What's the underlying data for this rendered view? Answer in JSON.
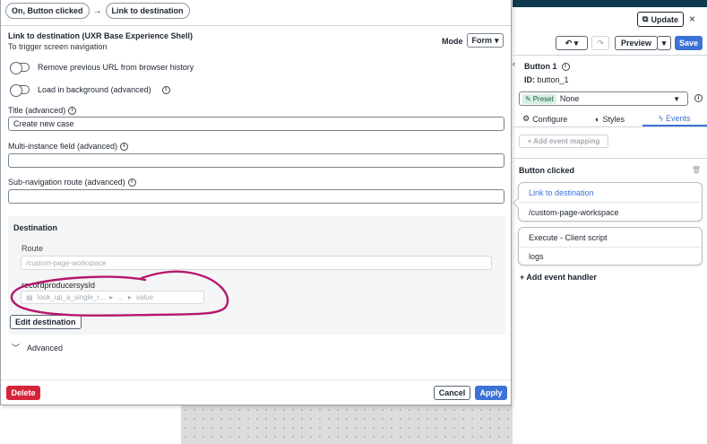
{
  "breadcrumbs": [
    "On, Button clicked",
    "Link to destination"
  ],
  "header": {
    "title": "Link to destination (UXR Base Experience Shell)",
    "subtitle": "To trigger screen navigation",
    "mode_label": "Mode",
    "mode_value": "Form"
  },
  "toggles": [
    {
      "label": "Remove previous URL from browser history"
    },
    {
      "label": "Load in background (advanced)"
    }
  ],
  "fields": {
    "title_label": "Title (advanced)",
    "title_value": "Create new case",
    "multi_label": "Multi-instance field (advanced)",
    "multi_value": "",
    "subnav_label": "Sub-navigation route (advanced)",
    "subnav_value": ""
  },
  "destination": {
    "title": "Destination",
    "route_label": "Route",
    "route_placeholder": "/custom-page-workspace",
    "param_label": "recordproducersysId",
    "param_path_1": "look_up_a_single_r...",
    "param_path_2": "...",
    "param_path_3": "value",
    "edit_button": "Edit destination",
    "advanced_label": "Advanced"
  },
  "footer": {
    "delete": "Delete",
    "cancel": "Cancel",
    "apply": "Apply"
  },
  "right_panel": {
    "update": "Update",
    "preview": "Preview",
    "save": "Save",
    "component_title": "Button 1",
    "component_id_label": "ID:",
    "component_id": "button_1",
    "preset_label": "Preset",
    "preset_value": "None",
    "tabs": [
      "Configure",
      "Styles",
      "Events"
    ],
    "add_mapping": "+ Add event mapping",
    "event_title": "Button clicked",
    "handler1_title": "Link to destination",
    "handler1_route": "/custom-page-workspace",
    "handler2_title": "Execute - Client script",
    "handler2_sub": "logs",
    "add_handler": "+ Add event handler"
  },
  "colors": {
    "primary": "#3c72d6",
    "danger": "#d6253b",
    "annotation": "#b5176e",
    "header_strip": "#0d3a4e"
  }
}
